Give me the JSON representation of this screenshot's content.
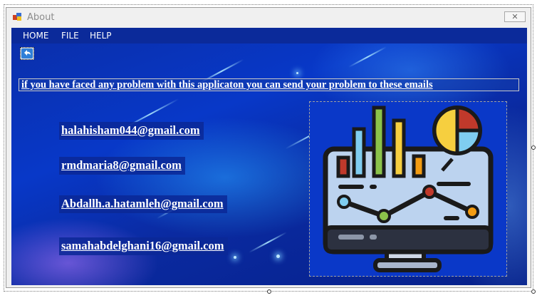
{
  "window": {
    "title": "About",
    "close_glyph": "✕"
  },
  "menu": {
    "items": [
      {
        "label": "HOME"
      },
      {
        "label": "FILE"
      },
      {
        "label": "HELP"
      }
    ]
  },
  "back_button": {
    "icon": "back-arrow-icon"
  },
  "info_label": "if you have faced any problem with this applicaton you can send your problem to these emails",
  "emails": [
    "halahisham044@gmail.com",
    "rmdmaria8@gmail.com",
    "Abdallh.a.hatamleh@gmail.com",
    "samahabdelghani16@gmail.com"
  ],
  "picture": {
    "icon": "analytics-monitor-icon"
  },
  "colors": {
    "menubar": "#0b2a9a",
    "client_background": "#0838c8",
    "email_background": "#0a2896",
    "text": "#ffffff"
  }
}
